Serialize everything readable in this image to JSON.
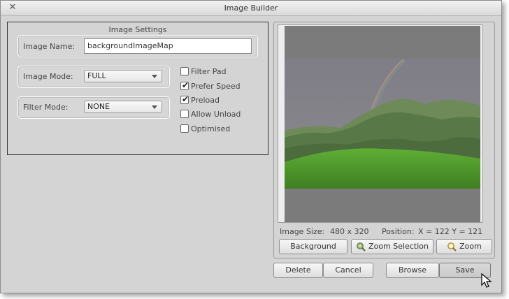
{
  "window": {
    "title": "Image Builder"
  },
  "settings": {
    "section_title": "Image Settings",
    "image_name_label": "Image Name:",
    "image_name_value": "backgroundImageMap",
    "image_mode_label": "Image Mode:",
    "image_mode_value": "FULL",
    "filter_mode_label": "Filter Mode:",
    "filter_mode_value": "NONE",
    "checkboxes": [
      {
        "label": "Filter Pad",
        "checked": false
      },
      {
        "label": "Prefer Speed",
        "checked": true
      },
      {
        "label": "Preload",
        "checked": true
      },
      {
        "label": "Allow Unload",
        "checked": false
      },
      {
        "label": "Optimised",
        "checked": false
      }
    ]
  },
  "preview": {
    "image_size_label": "Image Size:",
    "image_size_value": "480 x 320",
    "position_label": "Position:",
    "position_value": "X = 122  Y = 121",
    "background_label": "Background",
    "zoom_selection_label": "Zoom Selection",
    "zoom_label": "Zoom"
  },
  "footer": {
    "delete_label": "Delete",
    "cancel_label": "Cancel",
    "browse_label": "Browse",
    "save_label": "Save"
  },
  "colors": {
    "sky": "#86858b",
    "hills": "#5a7a45",
    "grass": "#4f9a2c",
    "letterbox": "#7b7b7b"
  }
}
